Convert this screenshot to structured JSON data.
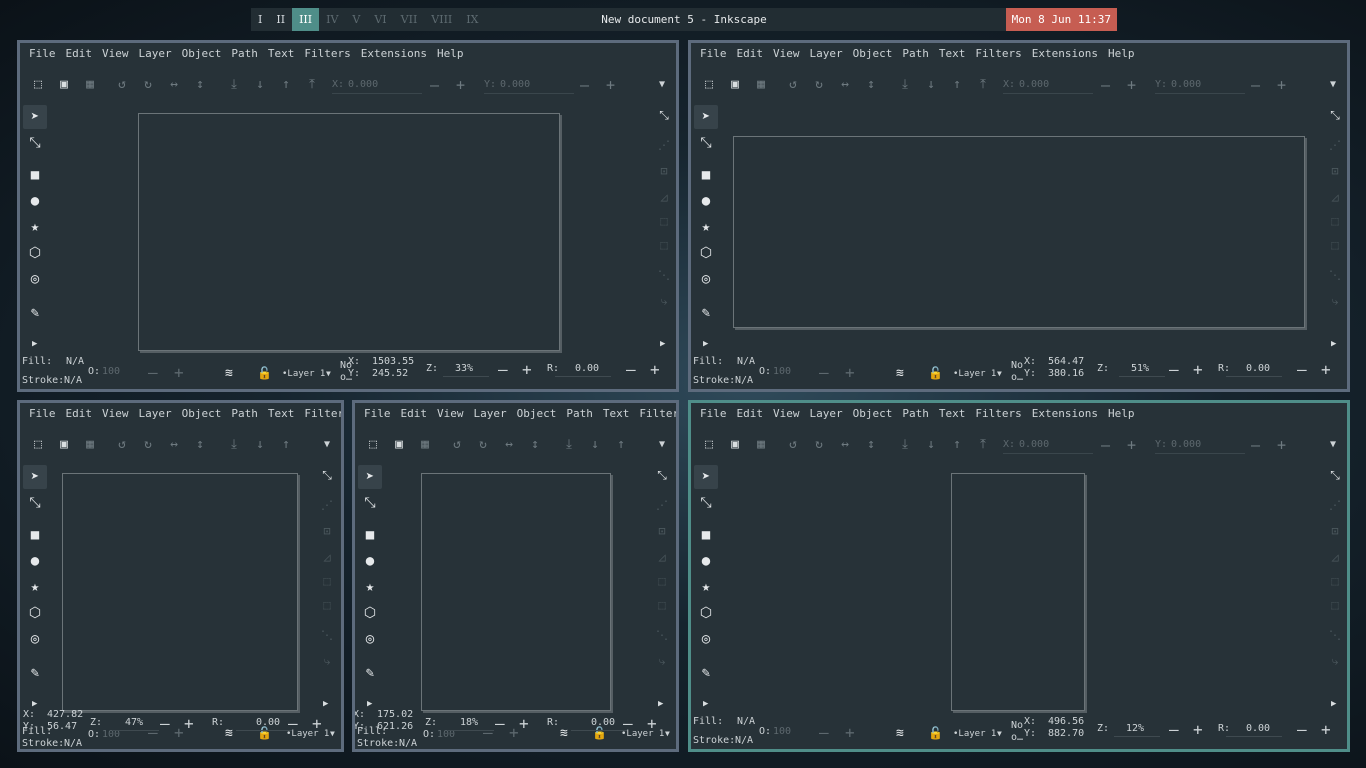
{
  "topbar": {
    "workspaces": [
      {
        "label": "I",
        "state": "occupied"
      },
      {
        "label": "II",
        "state": "occupied"
      },
      {
        "label": "III",
        "state": "active"
      },
      {
        "label": "IV",
        "state": "empty"
      },
      {
        "label": "V",
        "state": "empty"
      },
      {
        "label": "VI",
        "state": "empty"
      },
      {
        "label": "VII",
        "state": "empty"
      },
      {
        "label": "VIII",
        "state": "empty"
      },
      {
        "label": "IX",
        "state": "empty"
      }
    ],
    "title": "New document 5 - Inkscape",
    "clock": "Mon 8 Jun 11:37"
  },
  "colors": {
    "accent": "#4f8e89",
    "border": "#5d6b7d",
    "clock_bg": "#c65d52",
    "panel_bg": "#273238"
  },
  "app": {
    "menus": [
      "File",
      "Edit",
      "View",
      "Layer",
      "Object",
      "Path",
      "Text",
      "Filters",
      "Extensions",
      "Help"
    ],
    "toolbar": {
      "x_label": "X:",
      "x_value": "0.000",
      "y_label": "Y:",
      "y_value": "0.000"
    },
    "tools": [
      {
        "name": "selector-tool-icon",
        "glyph": "➤"
      },
      {
        "name": "node-tool-icon",
        "glyph": "⤡"
      },
      {
        "name": "rectangle-tool-icon",
        "glyph": "■"
      },
      {
        "name": "ellipse-tool-icon",
        "glyph": "●"
      },
      {
        "name": "star-tool-icon",
        "glyph": "★"
      },
      {
        "name": "box3d-tool-icon",
        "glyph": "⬡"
      },
      {
        "name": "spiral-tool-icon",
        "glyph": "◎"
      },
      {
        "name": "pencil-tool-icon",
        "glyph": "✎"
      }
    ],
    "status": {
      "fill_label": "Fill:",
      "fill_value": "N/A",
      "stroke_label": "Stroke:",
      "stroke_value": "N/A",
      "opacity_label": "O:",
      "opacity_value": "100",
      "layer": "•Layer 1",
      "no_selection": "No",
      "no_selection_2": "o…",
      "x_label": "X:",
      "y_label": "Y:",
      "zoom_label": "Z:",
      "rotation_label": "R:",
      "rotation_value": "0.00"
    }
  },
  "windows": [
    {
      "id": "top-left",
      "focused": false,
      "x": "1503.55",
      "y": "245.52",
      "zoom": "33%"
    },
    {
      "id": "top-right",
      "focused": false,
      "x": "564.47",
      "y": "380.16",
      "zoom": "51%"
    },
    {
      "id": "bottom-left",
      "focused": false,
      "x": "427.82",
      "y": "56.47",
      "zoom": "47%"
    },
    {
      "id": "bottom-middle",
      "focused": false,
      "x": "175.02",
      "y": "621.26",
      "zoom": "18%"
    },
    {
      "id": "bottom-right",
      "focused": true,
      "x": "496.56",
      "y": "882.70",
      "zoom": "12%"
    }
  ]
}
